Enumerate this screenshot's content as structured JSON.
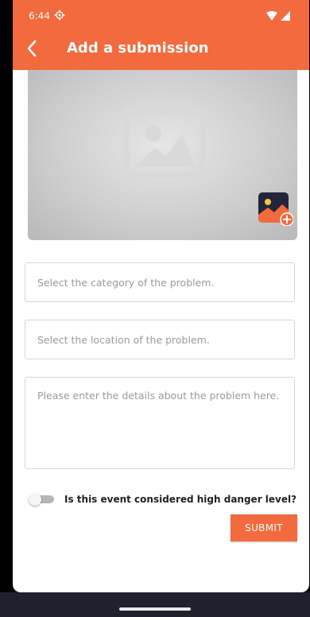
{
  "status_bar": {
    "time": "6:44",
    "settings_icon": "gear-icon",
    "wifi_icon": "wifi-icon",
    "signal_icon": "signal-icon"
  },
  "app_bar": {
    "back_icon": "chevron-left-icon",
    "title": "Add a submission",
    "background_color": "#f26a3d"
  },
  "image_picker": {
    "placeholder_icon": "image-placeholder-icon",
    "add_icon": "add-image-icon"
  },
  "form": {
    "category_placeholder": "Select the category of the problem.",
    "location_placeholder": "Select the location of the problem.",
    "details_placeholder": "Please enter the details about the problem here.",
    "danger_toggle_label": "Is this event considered high danger level?",
    "danger_toggle_on": false,
    "submit_label": "SUBMIT"
  },
  "colors": {
    "accent": "#f26a3d",
    "nav_bar": "#1f222c"
  }
}
